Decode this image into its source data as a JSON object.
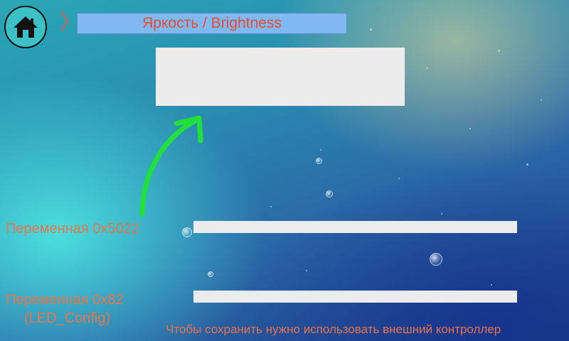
{
  "header": {
    "home_icon": "home-icon",
    "chevron": "〉",
    "title": "Яркость / Brightness"
  },
  "variables": [
    {
      "label": "Переменная 0x5022"
    },
    {
      "label": "Переменная 0x82",
      "sublabel": "(LED_Config)"
    }
  ],
  "footer": {
    "note": "Чтобы сохранить нужно использовать внешний контроллер"
  },
  "colors": {
    "title_text": "#e8493a",
    "label_text": "#e8744a",
    "title_bar": "#7fb9f0",
    "arrow": "#22e03a",
    "field": "#ececec"
  }
}
